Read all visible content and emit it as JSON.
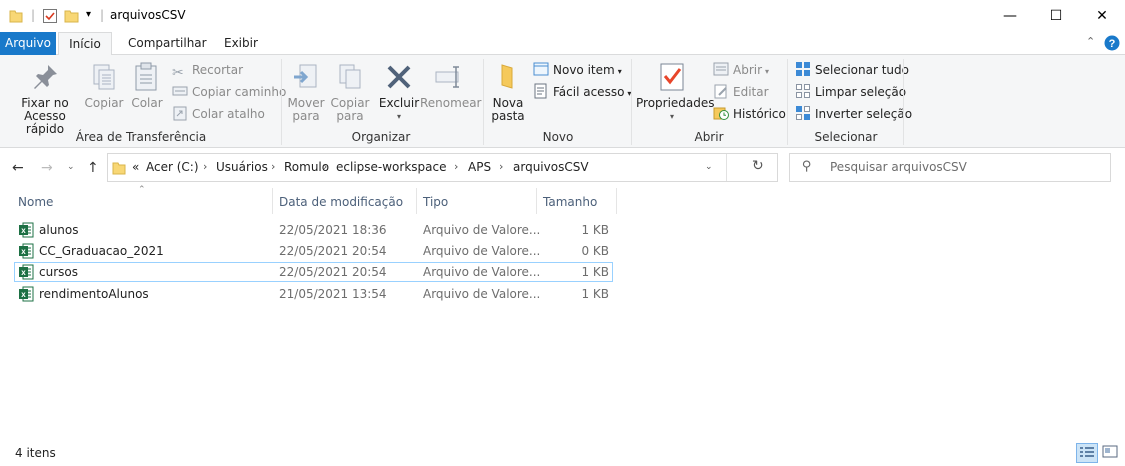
{
  "window": {
    "title": "arquivosCSV",
    "controls": {
      "minimize": "—",
      "maximize": "☐",
      "close": "✕"
    }
  },
  "tabs": [
    {
      "label": "Arquivo"
    },
    {
      "label": "Início"
    },
    {
      "label": "Compartilhar"
    },
    {
      "label": "Exibir"
    }
  ],
  "ribbon": {
    "clipboard": {
      "group_label": "Área de Transferência",
      "pin_line1": "Fixar no",
      "pin_line2": "Acesso rápido",
      "copy": "Copiar",
      "paste": "Colar",
      "cut": "Recortar",
      "copy_path": "Copiar caminho",
      "paste_shortcut": "Colar atalho"
    },
    "organize": {
      "group_label": "Organizar",
      "move_line1": "Mover",
      "move_line2": "para",
      "copyto_line1": "Copiar",
      "copyto_line2": "para",
      "delete": "Excluir",
      "rename": "Renomear"
    },
    "new": {
      "group_label": "Novo",
      "new_folder_line1": "Nova",
      "new_folder_line2": "pasta",
      "new_item": "Novo item",
      "easy_access": "Fácil acesso"
    },
    "open": {
      "group_label": "Abrir",
      "properties": "Propriedades",
      "open": "Abrir",
      "edit": "Editar",
      "history": "Histórico"
    },
    "select": {
      "group_label": "Selecionar",
      "select_all": "Selecionar tudo",
      "select_none": "Limpar seleção",
      "invert": "Inverter seleção"
    }
  },
  "address": {
    "overflow": "«",
    "crumbs": [
      "Acer (C:)",
      "Usuários",
      "Romulo",
      "eclipse-workspace",
      "APS",
      "arquivosCSV"
    ]
  },
  "search": {
    "placeholder": "Pesquisar arquivosCSV"
  },
  "columns": {
    "name": "Nome",
    "modified": "Data de modificação",
    "type": "Tipo",
    "size": "Tamanho"
  },
  "files": [
    {
      "name": "alunos",
      "modified": "22/05/2021 18:36",
      "type": "Arquivo de Valore...",
      "size": "1 KB"
    },
    {
      "name": "CC_Graduacao_2021",
      "modified": "22/05/2021 20:54",
      "type": "Arquivo de Valore...",
      "size": "0 KB"
    },
    {
      "name": "cursos",
      "modified": "22/05/2021 20:54",
      "type": "Arquivo de Valore...",
      "size": "1 KB"
    },
    {
      "name": "rendimentoAlunos",
      "modified": "21/05/2021 13:54",
      "type": "Arquivo de Valore...",
      "size": "1 KB"
    }
  ],
  "status": {
    "item_count": "4 itens"
  },
  "colors": {
    "accent": "#1979ca",
    "selection_border": "#99d1ff",
    "excel_green": "#1d7044",
    "folder_yellow": "#f8d775"
  }
}
